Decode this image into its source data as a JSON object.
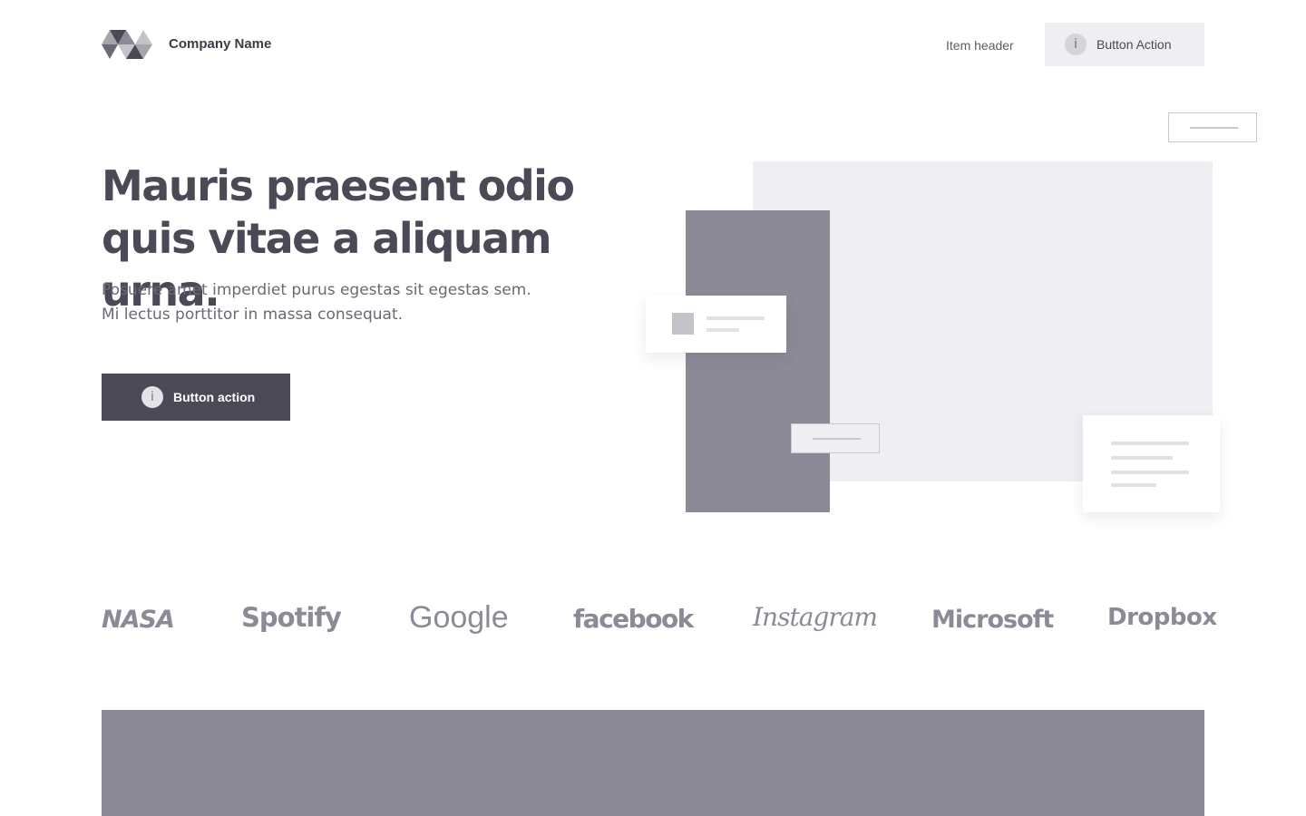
{
  "header": {
    "company_name": "Company Name",
    "nav_item": "Item header",
    "button_label": "Button Action",
    "button_icon": "i"
  },
  "hero": {
    "title": "Mauris praesent odio quis vitae a aliquam urna.",
    "subtitle_line1": "Posuere amet imperdiet purus egestas sit egestas sem.",
    "subtitle_line2": "Mi lectus porttitor in massa consequat.",
    "button_label": "Button action",
    "button_icon": "i"
  },
  "logos": [
    "NASA",
    "Spotify",
    "Google",
    "facebook",
    "Instagram",
    "Microsoft",
    "Dropbox"
  ],
  "colors": {
    "primary_dark": "#4a4955",
    "mid_gray": "#8c8a96",
    "light_bg": "#efeef3"
  }
}
